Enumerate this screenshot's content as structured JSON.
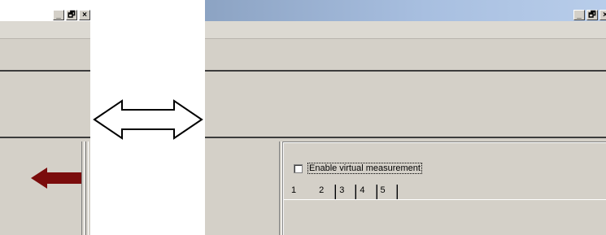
{
  "colors": {
    "window_bg": "#d4d0c8",
    "titlebar_gradient_start": "#8ca3c3",
    "red_arrow": "#7a0c0c"
  },
  "window_buttons": {
    "minimize": "_",
    "restore": "🗗",
    "close": "×"
  },
  "right_window": {
    "checkbox_label": "Enable virtual measurement",
    "checkbox_checked": false,
    "tabs": [
      "1",
      "2",
      "3",
      "4",
      "5"
    ],
    "active_tab": "1"
  },
  "icons": {
    "resize_arrow": "double-headed-arrow-icon",
    "red_arrow": "left-arrow-icon"
  }
}
